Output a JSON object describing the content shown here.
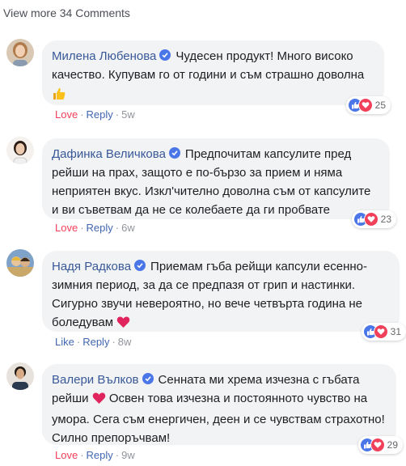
{
  "view_more": "View more 34 Comments",
  "comments": [
    {
      "author": "Милена Любенова",
      "text": "Чудесен продукт! Много високо качество. Купувам го от години и съм страшно доволна",
      "emoji": "thumbs-up-emoji",
      "reaction_count": "25",
      "action": "Love",
      "reply": "Reply",
      "time": "5w"
    },
    {
      "author": "Дафинка Величкова",
      "text": "Предпочитам капсулите пред рейши на прах, защото е по-бързо за прием и няма неприятен вкус. Изкл'чително доволна съм от капсулите и ви съветвам да не се колебаете да ги пробвате",
      "emoji": "",
      "reaction_count": "23",
      "action": "Love",
      "reply": "Reply",
      "time": "6w"
    },
    {
      "author": "Надя Радкова",
      "text": "Приемам гъба рейщи капсули есенно-зимния период, за да се предпазя от грип и настинки. Сигурно звучи невероятно, но вече четвърта година не боледувам",
      "emoji": "heart-emoji",
      "reaction_count": "31",
      "action": "Like",
      "reply": "Reply",
      "time": "8w"
    },
    {
      "author": "Валери Вълков",
      "text_before": "Сенната ми хрема изчезна с гъбата рейши",
      "text_after": "Освен това изчезна и постоянното чувство на умора. Сега съм енергичен, деен и се чувствам страхотно! Силно препоръчвам!",
      "emoji": "heart-emoji",
      "reaction_count": "29",
      "action": "Love",
      "reply": "Reply",
      "time": "9w"
    }
  ],
  "dot": "·",
  "colors": {
    "author": "#385898",
    "love": "#f33e58",
    "like": "#4267b2",
    "bubble": "#f2f3f5"
  }
}
